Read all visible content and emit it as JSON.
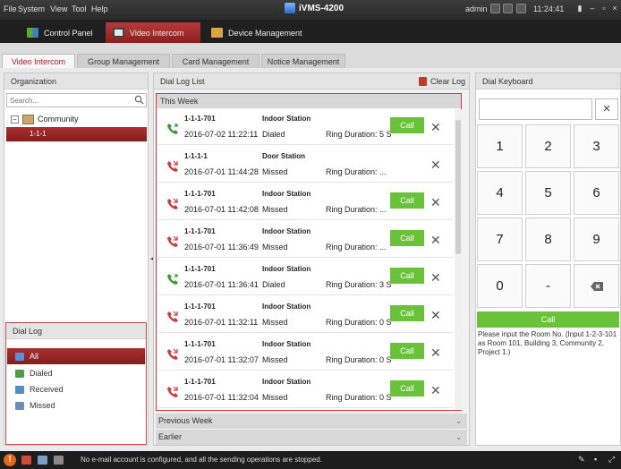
{
  "app": {
    "title": "iVMS-4200",
    "user": "admin",
    "time": "11:24:41"
  },
  "menu": [
    "File",
    "System",
    "View",
    "Tool",
    "Help"
  ],
  "modules": [
    {
      "label": "Control Panel",
      "active": false
    },
    {
      "label": "Video Intercom",
      "active": true
    },
    {
      "label": "Device Management",
      "active": false
    }
  ],
  "subtabs": [
    {
      "label": "Video Intercom",
      "active": true
    },
    {
      "label": "Group Management",
      "active": false
    },
    {
      "label": "Card Management",
      "active": false
    },
    {
      "label": "Notice Management",
      "active": false
    }
  ],
  "organization": {
    "header": "Organization",
    "search_placeholder": "Search...",
    "root": "Community",
    "child": "1-1-1"
  },
  "dial_log_filter": {
    "header": "Dial Log",
    "items": [
      "All",
      "Dialed",
      "Received",
      "Missed"
    ],
    "selected": "All"
  },
  "dial_log_list": {
    "header": "Dial Log List",
    "clear_label": "Clear Log",
    "group_this_week": "This Week",
    "group_previous_week": "Previous Week",
    "group_earlier": "Earlier",
    "call_label": "Call",
    "rows": [
      {
        "number": "1-1-1-701",
        "device": "Indoor Station",
        "timestamp": "2016-07-02 11:22:11",
        "status": "Dialed",
        "duration": "Ring Duration: 5 S",
        "kind": "dialed",
        "has_call": true
      },
      {
        "number": "1-1-1-1",
        "device": "Door Station",
        "timestamp": "2016-07-01 11:44:28",
        "status": "Missed",
        "duration": "Ring Duration: ...",
        "kind": "missed",
        "has_call": false
      },
      {
        "number": "1-1-1-701",
        "device": "Indoor Station",
        "timestamp": "2016-07-01 11:42:08",
        "status": "Missed",
        "duration": "Ring Duration: ...",
        "kind": "missed",
        "has_call": true
      },
      {
        "number": "1-1-1-701",
        "device": "Indoor Station",
        "timestamp": "2016-07-01 11:36:49",
        "status": "Missed",
        "duration": "Ring Duration: ...",
        "kind": "missed",
        "has_call": true
      },
      {
        "number": "1-1-1-701",
        "device": "Indoor Station",
        "timestamp": "2016-07-01 11:36:41",
        "status": "Dialed",
        "duration": "Ring Duration: 3 S",
        "kind": "dialed",
        "has_call": true
      },
      {
        "number": "1-1-1-701",
        "device": "Indoor Station",
        "timestamp": "2016-07-01 11:32:11",
        "status": "Missed",
        "duration": "Ring Duration: 0 S",
        "kind": "missed",
        "has_call": true
      },
      {
        "number": "1-1-1-701",
        "device": "Indoor Station",
        "timestamp": "2016-07-01 11:32:07",
        "status": "Missed",
        "duration": "Ring Duration: 0 S",
        "kind": "missed",
        "has_call": true
      },
      {
        "number": "1-1-1-701",
        "device": "Indoor Station",
        "timestamp": "2016-07-01 11:32:04",
        "status": "Missed",
        "duration": "Ring Duration: 0 S",
        "kind": "missed",
        "has_call": true
      }
    ]
  },
  "keyboard": {
    "header": "Dial Keyboard",
    "keys": [
      "1",
      "2",
      "3",
      "4",
      "5",
      "6",
      "7",
      "8",
      "9",
      "0",
      "-"
    ],
    "call_label": "Call",
    "hint": "Please input the Room No. (Input 1-2-3-101 as Room 101, Building 3, Community 2, Project 1.)"
  },
  "status": {
    "message": "No e-mail account is configured, and all the sending operations are stopped."
  },
  "colors": {
    "accent_red": "#a93030",
    "call_green": "#6ac23b",
    "missed_red": "#d23b3b",
    "dialed_green": "#3a9a2e"
  }
}
